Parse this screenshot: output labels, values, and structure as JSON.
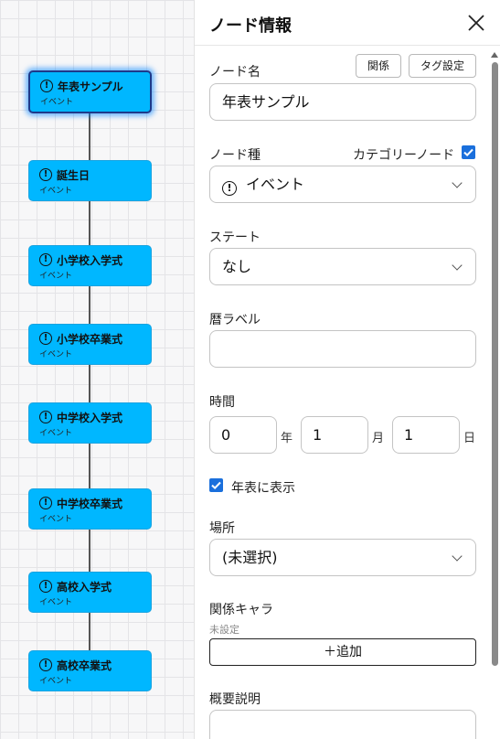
{
  "canvas": {
    "nodes": [
      {
        "title": "年表サンプル",
        "type": "イベント",
        "icon": "exclamation-circle-icon",
        "selected": true
      },
      {
        "title": "誕生日",
        "type": "イベント",
        "icon": "exclamation-circle-icon"
      },
      {
        "title": "小学校入学式",
        "type": "イベント",
        "icon": "exclamation-circle-icon"
      },
      {
        "title": "小学校卒業式",
        "type": "イベント",
        "icon": "exclamation-circle-icon"
      },
      {
        "title": "中学校入学式",
        "type": "イベント",
        "icon": "exclamation-circle-icon"
      },
      {
        "title": "中学校卒業式",
        "type": "イベント",
        "icon": "exclamation-circle-icon"
      },
      {
        "title": "高校入学式",
        "type": "イベント",
        "icon": "exclamation-circle-icon"
      },
      {
        "title": "高校卒業式",
        "type": "イベント",
        "icon": "exclamation-circle-icon"
      }
    ],
    "node_color": "#00b7ff",
    "edge_color": "#555555"
  },
  "panel": {
    "title": "ノード情報",
    "close_icon": "close-icon",
    "relation_button": "関係",
    "tag_button": "タグ設定",
    "node_name_label": "ノード名",
    "node_name_value": "年表サンプル",
    "node_type_label": "ノード種",
    "category_node_label": "カテゴリーノード",
    "category_node_checked": true,
    "node_type_value": "イベント",
    "node_type_icon": "exclamation-circle-icon",
    "state_label": "ステート",
    "state_value": "なし",
    "calendar_label": "暦ラベル",
    "calendar_value": "",
    "time_label": "時間",
    "year_value": "0",
    "year_unit": "年",
    "month_value": "1",
    "month_unit": "月",
    "day_value": "1",
    "day_unit": "日",
    "show_in_timeline_label": "年表に表示",
    "show_in_timeline_checked": true,
    "place_label": "場所",
    "place_value": "(未選択)",
    "related_chars_label": "関係キャラ",
    "related_chars_empty": "未設定",
    "add_button": "＋追加",
    "summary_label": "概要説明",
    "checkbox_color": "#1a6fdc"
  }
}
